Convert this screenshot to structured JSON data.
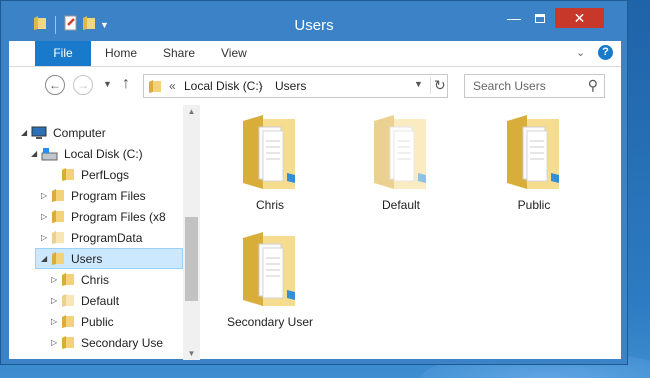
{
  "window": {
    "title": "Users"
  },
  "ribbon": {
    "tabs": {
      "file": "File",
      "home": "Home",
      "share": "Share",
      "view": "View"
    }
  },
  "navbar": {
    "breadcrumb": {
      "chevron": "«",
      "drive": "Local Disk (C:)",
      "separator": "›",
      "folder": "Users"
    },
    "search_placeholder": "Search Users"
  },
  "tree": {
    "computer": "Computer",
    "local_disk": "Local Disk (C:)",
    "perflogs": "PerfLogs",
    "program_files": "Program Files",
    "program_files_x86": "Program Files (x8",
    "programdata": "ProgramData",
    "users": "Users",
    "chris": "Chris",
    "default": "Default",
    "public": "Public",
    "secondary_user": "Secondary Use"
  },
  "files": [
    {
      "name": "Chris"
    },
    {
      "name": "Default"
    },
    {
      "name": "Public"
    },
    {
      "name": "Secondary User"
    }
  ],
  "colors": {
    "titlebar": "#3c82c6",
    "file_tab": "#1979ca",
    "close_button": "#c7382b",
    "selection": "#cce8ff"
  },
  "icons": {
    "folder": "folder-icon",
    "computer": "computer-icon",
    "drive": "drive-icon",
    "back": "back-arrow-icon",
    "forward": "forward-arrow-icon",
    "up": "up-arrow-icon",
    "refresh": "refresh-icon",
    "search": "search-icon",
    "help": "help-icon"
  }
}
